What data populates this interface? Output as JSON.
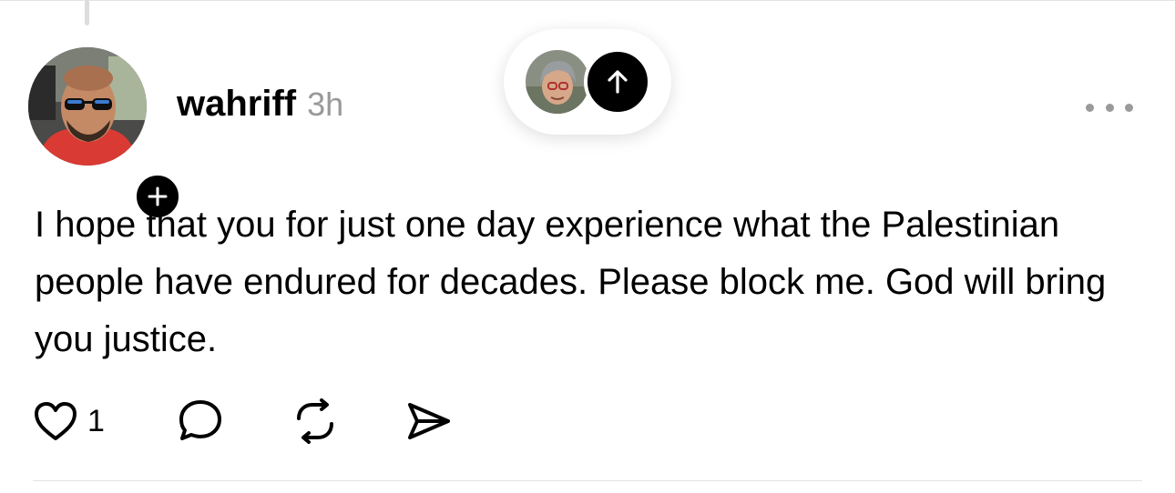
{
  "post": {
    "author": {
      "username": "wahriff",
      "avatar_icon": "profile-photo",
      "follow_icon": "plus-icon"
    },
    "timestamp": "3h",
    "more_icon": "ellipsis-icon",
    "text": "I hope that you for just one day experience what the Palestinian people have endured for decades. Please block me. God will bring you justice.",
    "actions": {
      "like_icon": "heart-icon",
      "like_count": "1",
      "reply_icon": "comment-icon",
      "repost_icon": "repost-icon",
      "share_icon": "send-icon"
    }
  },
  "new_posts_pill": {
    "avatar_icon": "profile-photo",
    "arrow_icon": "arrow-up-icon"
  },
  "colors": {
    "text": "#000000",
    "muted": "#999999",
    "divider": "#e3e3e3",
    "badge": "#000000"
  }
}
